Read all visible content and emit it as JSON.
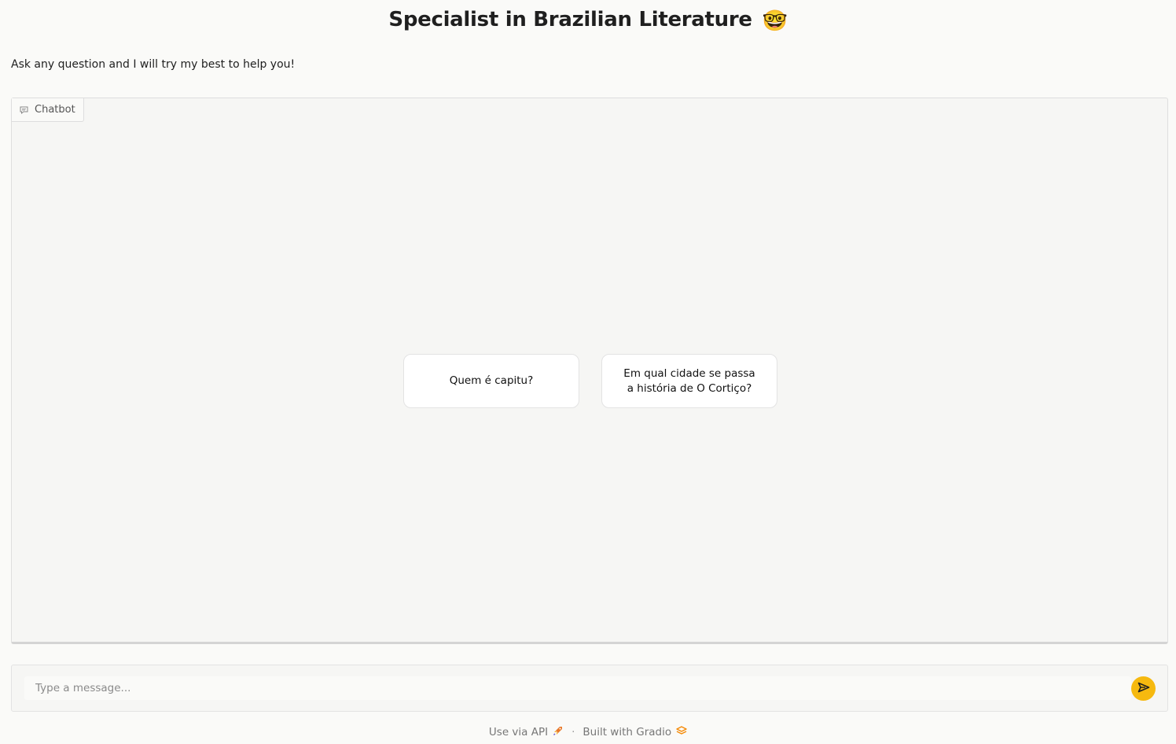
{
  "header": {
    "title": "Specialist in Brazilian Literature",
    "title_emoji": "🤓",
    "description": "Ask any question and I will try my best to help you!"
  },
  "chatbot": {
    "label": "Chatbot",
    "label_icon": "chat-bubble-icon",
    "examples": [
      "Quem é capitu?",
      "Em qual cidade se passa a história de O Cortiço?"
    ]
  },
  "input": {
    "placeholder": "Type a message...",
    "value": "",
    "send_icon": "send-arrow-icon",
    "send_color": "#f6b90f"
  },
  "footer": {
    "api_link": "Use via API",
    "api_icon": "rocket-icon",
    "separator": "·",
    "built_with": "Built with Gradio",
    "gradio_icon": "gradio-logo-icon"
  }
}
